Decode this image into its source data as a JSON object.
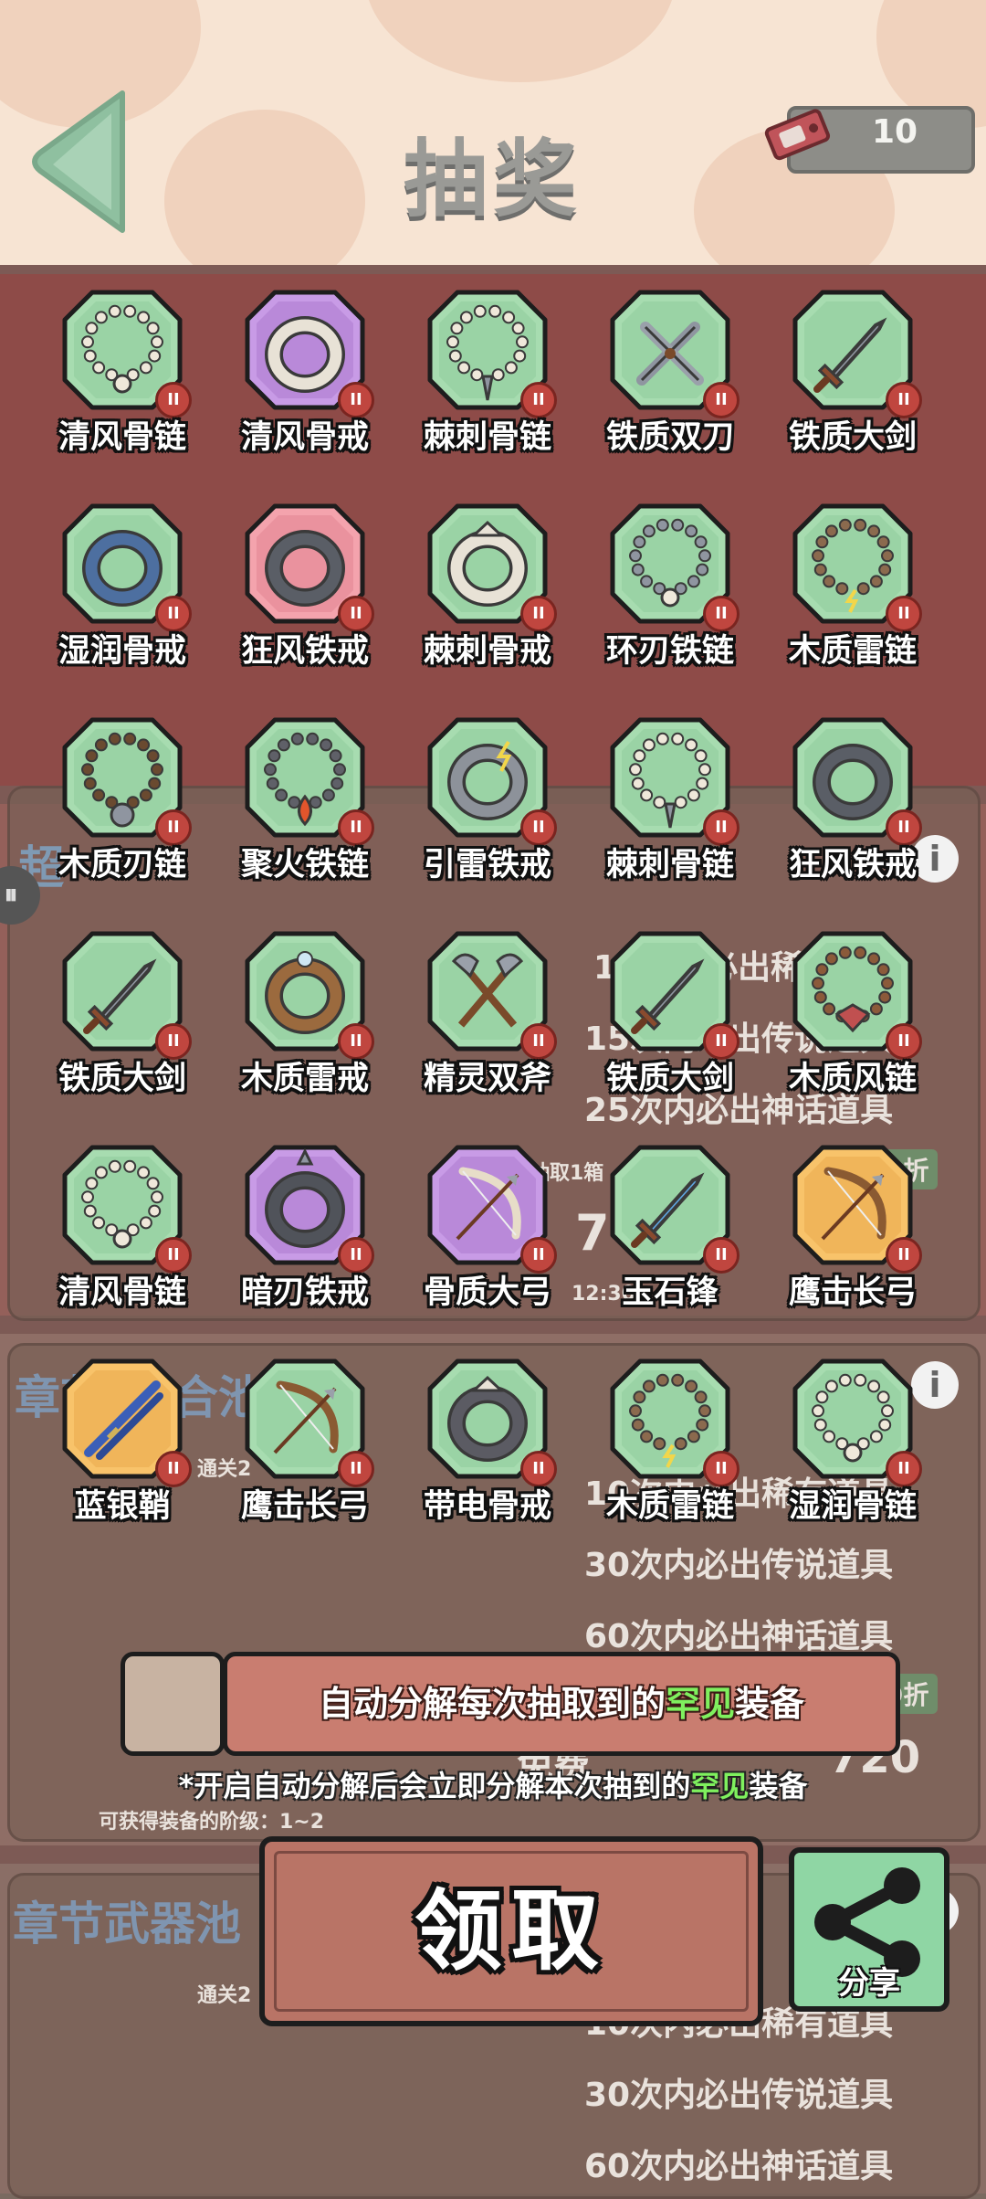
{
  "header": {
    "title": "抽奖",
    "ticket_count": "10"
  },
  "background": {
    "pool1_header": "超",
    "pool1_lines": [
      "10次内必出稀有道具",
      "15次内必出传说道具",
      "25次内必出神话道具"
    ],
    "pool1_discount": "9折",
    "pool1_cost_label": "抽取1箱",
    "pool1_cost": "7",
    "pool1_time": "12:30",
    "pool2_header": "章节(混合池)",
    "pool2_unlock": "通关2",
    "pool2_lines": [
      "10次内必出稀有道具",
      "30次内必出传说道具",
      "60次内必出神话道具"
    ],
    "pool2_discount": "9折",
    "pool2_cost": "720",
    "pool2_free": "免费",
    "pool2_tier_label": "可获得装备的阶级：1~2",
    "pool3_header": "章节武器池",
    "pool3_unlock": "通关2",
    "pool3_lines": [
      "10次内必出稀有道具",
      "30次内必出传说道具",
      "60次内必出神话道具"
    ]
  },
  "rewards": [
    {
      "name": "清风骨链",
      "rarity": "common",
      "icon": "bone-necklace-icon",
      "level": "II"
    },
    {
      "name": "清风骨戒",
      "rarity": "epic",
      "icon": "bone-ring-icon",
      "level": "II"
    },
    {
      "name": "棘刺骨链",
      "rarity": "common",
      "icon": "thorn-necklace-icon",
      "level": "II"
    },
    {
      "name": "铁质双刀",
      "rarity": "common",
      "icon": "twin-blades-icon",
      "level": "II"
    },
    {
      "name": "铁质大剑",
      "rarity": "common",
      "icon": "greatsword-icon",
      "level": "II"
    },
    {
      "name": "湿润骨戒",
      "rarity": "common",
      "icon": "wet-bone-ring-icon",
      "level": "II"
    },
    {
      "name": "狂风铁戒",
      "rarity": "rare-red",
      "icon": "iron-ring-icon",
      "level": "II"
    },
    {
      "name": "棘刺骨戒",
      "rarity": "common",
      "icon": "thorn-ring-icon",
      "level": "II"
    },
    {
      "name": "环刃铁链",
      "rarity": "common",
      "icon": "blade-chain-icon",
      "level": "II"
    },
    {
      "name": "木质雷链",
      "rarity": "common",
      "icon": "wood-bead-necklace-icon",
      "level": "II"
    },
    {
      "name": "木质刃链",
      "rarity": "common",
      "icon": "wood-blade-necklace-icon",
      "level": "II"
    },
    {
      "name": "聚火铁链",
      "rarity": "common",
      "icon": "fire-necklace-icon",
      "level": "II"
    },
    {
      "name": "引雷铁戒",
      "rarity": "common",
      "icon": "thunder-ring-icon",
      "level": "II"
    },
    {
      "name": "棘刺骨链",
      "rarity": "common",
      "icon": "thorn-necklace-icon",
      "level": "II"
    },
    {
      "name": "狂风铁戒",
      "rarity": "common",
      "icon": "iron-ring-icon",
      "level": "II"
    },
    {
      "name": "铁质大剑",
      "rarity": "common",
      "icon": "greatsword-icon",
      "level": "II"
    },
    {
      "name": "木质雷戒",
      "rarity": "common",
      "icon": "wood-ring-icon",
      "level": "II"
    },
    {
      "name": "精灵双斧",
      "rarity": "common",
      "icon": "twin-axes-icon",
      "level": "II"
    },
    {
      "name": "铁质大剑",
      "rarity": "common",
      "icon": "greatsword-icon",
      "level": "II"
    },
    {
      "name": "木质风链",
      "rarity": "common",
      "icon": "wind-necklace-icon",
      "level": "II"
    },
    {
      "name": "清风骨链",
      "rarity": "common",
      "icon": "bone-necklace-icon",
      "level": "II"
    },
    {
      "name": "暗刃铁戒",
      "rarity": "epic",
      "icon": "dark-blade-ring-icon",
      "level": "II"
    },
    {
      "name": "骨质大弓",
      "rarity": "epic",
      "icon": "bone-bow-icon",
      "level": "II"
    },
    {
      "name": "玉石锋",
      "rarity": "common",
      "icon": "jade-sword-icon",
      "level": "II"
    },
    {
      "name": "鹰击长弓",
      "rarity": "legendary",
      "icon": "longbow-icon",
      "level": "II"
    },
    {
      "name": "蓝银鞘",
      "rarity": "legendary",
      "icon": "katana-icon",
      "level": "II"
    },
    {
      "name": "鹰击长弓",
      "rarity": "common",
      "icon": "longbow-icon",
      "level": "II"
    },
    {
      "name": "带电骨戒",
      "rarity": "common",
      "icon": "skull-ring-icon",
      "level": "II"
    },
    {
      "name": "木质雷链",
      "rarity": "common",
      "icon": "wood-bead-necklace-icon",
      "level": "II"
    },
    {
      "name": "湿润骨链",
      "rarity": "common",
      "icon": "wet-bone-necklace-icon",
      "level": "II"
    }
  ],
  "auto_decompose": {
    "prefix": "自动分解每次抽取到的",
    "highlight": "罕见",
    "suffix": "装备",
    "note_prefix": "*开启自动分解后会立即分解本次抽到的",
    "note_highlight": "罕见",
    "note_suffix": "装备",
    "checked": false
  },
  "buttons": {
    "claim": "领取",
    "share": "分享"
  },
  "colors": {
    "common_tile": "#a7dcb0",
    "epic_tile": "#c89be6",
    "rare_red_tile": "#f4a3ad",
    "legendary_tile": "#f8c36a",
    "badge_red": "#c0463f",
    "highlight_green": "#7ff05e"
  }
}
